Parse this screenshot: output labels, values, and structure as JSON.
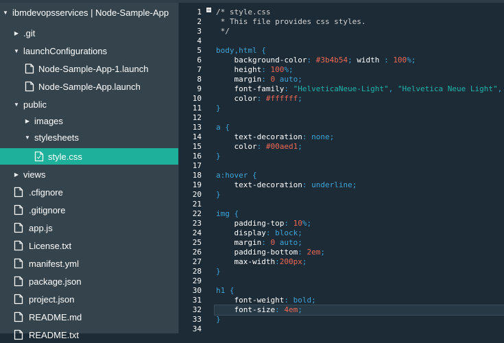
{
  "sidebar": {
    "project": "ibmdevopsservices | Node-Sample-App",
    "items": [
      {
        "label": ".git",
        "type": "folder",
        "state": "collapsed",
        "depth": 1
      },
      {
        "label": "launchConfigurations",
        "type": "folder",
        "state": "expanded",
        "depth": 1
      },
      {
        "label": "Node-Sample-App-1.launch",
        "type": "file",
        "depth": 2
      },
      {
        "label": "Node-Sample-App.launch",
        "type": "file",
        "depth": 2
      },
      {
        "label": "public",
        "type": "folder",
        "state": "expanded",
        "depth": 1
      },
      {
        "label": "images",
        "type": "folder",
        "state": "collapsed",
        "depth": 2
      },
      {
        "label": "stylesheets",
        "type": "folder",
        "state": "expanded",
        "depth": 2
      },
      {
        "label": "style.css",
        "type": "file",
        "depth": 3,
        "selected": true
      },
      {
        "label": "views",
        "type": "folder",
        "state": "collapsed",
        "depth": 1
      },
      {
        "label": ".cfignore",
        "type": "file",
        "depth": 1
      },
      {
        "label": ".gitignore",
        "type": "file",
        "depth": 1
      },
      {
        "label": "app.js",
        "type": "file",
        "depth": 1
      },
      {
        "label": "License.txt",
        "type": "file",
        "depth": 1
      },
      {
        "label": "manifest.yml",
        "type": "file",
        "depth": 1
      },
      {
        "label": "package.json",
        "type": "file",
        "depth": 1
      },
      {
        "label": "project.json",
        "type": "file",
        "depth": 1
      },
      {
        "label": "README.md",
        "type": "file",
        "depth": 1
      },
      {
        "label": "README.txt",
        "type": "file",
        "depth": 1
      }
    ]
  },
  "editor": {
    "active_line": 32,
    "lines": [
      [
        [
          "c",
          "/* style.css"
        ]
      ],
      [
        [
          "c",
          " * This file provides css styles."
        ]
      ],
      [
        [
          "c",
          " */"
        ]
      ],
      [],
      [
        [
          "s",
          "body,html {"
        ]
      ],
      [
        [
          "p",
          "    background-color"
        ],
        [
          "pu",
          ": "
        ],
        [
          "n",
          "#3b4b54"
        ],
        [
          "pu",
          "; "
        ],
        [
          "p",
          "width "
        ],
        [
          "pu",
          ": "
        ],
        [
          "n",
          "100"
        ],
        [
          "pu",
          "%;"
        ]
      ],
      [
        [
          "p",
          "    height"
        ],
        [
          "pu",
          ": "
        ],
        [
          "n",
          "100"
        ],
        [
          "pu",
          "%;"
        ]
      ],
      [
        [
          "p",
          "    margin"
        ],
        [
          "pu",
          ": "
        ],
        [
          "n",
          "0"
        ],
        [
          "v",
          " auto"
        ],
        [
          "pu",
          ";"
        ]
      ],
      [
        [
          "p",
          "    font-family"
        ],
        [
          "pu",
          ": "
        ],
        [
          "st",
          "\"HelveticaNeue-Light\""
        ],
        [
          "pu",
          ", "
        ],
        [
          "st",
          "\"Helvetica Neue Light\""
        ],
        [
          "pu",
          ","
        ]
      ],
      [
        [
          "p",
          "    color"
        ],
        [
          "pu",
          ": "
        ],
        [
          "n",
          "#ffffff"
        ],
        [
          "pu",
          ";"
        ]
      ],
      [
        [
          "s",
          "}"
        ]
      ],
      [],
      [
        [
          "s",
          "a {"
        ]
      ],
      [
        [
          "p",
          "    text-decoration"
        ],
        [
          "pu",
          ": "
        ],
        [
          "v",
          "none"
        ],
        [
          "pu",
          ";"
        ]
      ],
      [
        [
          "p",
          "    color"
        ],
        [
          "pu",
          ": "
        ],
        [
          "n",
          "#00aed1"
        ],
        [
          "pu",
          ";"
        ]
      ],
      [
        [
          "s",
          "}"
        ]
      ],
      [],
      [
        [
          "s",
          "a:hover {"
        ]
      ],
      [
        [
          "p",
          "    text-decoration"
        ],
        [
          "pu",
          ": "
        ],
        [
          "v",
          "underline"
        ],
        [
          "pu",
          ";"
        ]
      ],
      [
        [
          "s",
          "}"
        ]
      ],
      [],
      [
        [
          "s",
          "img {"
        ]
      ],
      [
        [
          "p",
          "    padding-top"
        ],
        [
          "pu",
          ": "
        ],
        [
          "n",
          "10"
        ],
        [
          "pu",
          "%;"
        ]
      ],
      [
        [
          "p",
          "    display"
        ],
        [
          "pu",
          ": "
        ],
        [
          "v",
          "block"
        ],
        [
          "pu",
          ";"
        ]
      ],
      [
        [
          "p",
          "    margin"
        ],
        [
          "pu",
          ": "
        ],
        [
          "n",
          "0"
        ],
        [
          "v",
          " auto"
        ],
        [
          "pu",
          ";"
        ]
      ],
      [
        [
          "p",
          "    padding-bottom"
        ],
        [
          "pu",
          ": "
        ],
        [
          "n",
          "2em"
        ],
        [
          "pu",
          ";"
        ]
      ],
      [
        [
          "p",
          "    max-width"
        ],
        [
          "pu",
          ":"
        ],
        [
          "n",
          "200px"
        ],
        [
          "pu",
          ";"
        ]
      ],
      [
        [
          "s",
          "}"
        ]
      ],
      [],
      [
        [
          "s",
          "h1 {"
        ]
      ],
      [
        [
          "p",
          "    font-weight"
        ],
        [
          "pu",
          ": "
        ],
        [
          "v",
          "bold"
        ],
        [
          "pu",
          ";"
        ]
      ],
      [
        [
          "p",
          "    font-size"
        ],
        [
          "pu",
          ": "
        ],
        [
          "n",
          "4em"
        ],
        [
          "pu",
          ";"
        ]
      ],
      [
        [
          "s",
          "}"
        ]
      ],
      []
    ]
  },
  "line_numbers": [
    "1",
    "2",
    "3",
    "4",
    "5",
    "6",
    "7",
    "8",
    "9",
    "10",
    "11",
    "12",
    "13",
    "14",
    "15",
    "16",
    "17",
    "18",
    "19",
    "20",
    "21",
    "22",
    "23",
    "24",
    "25",
    "26",
    "27",
    "28",
    "29",
    "30",
    "31",
    "32",
    "33",
    "34"
  ],
  "fold_marker": "−"
}
